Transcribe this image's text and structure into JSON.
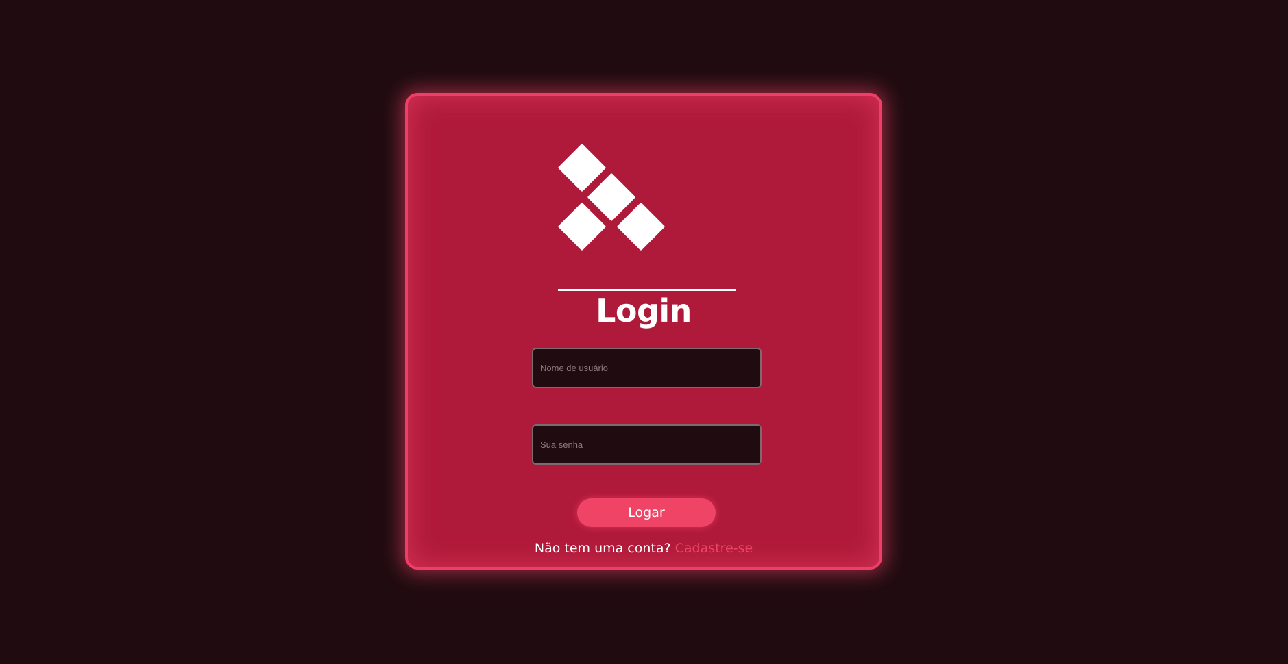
{
  "login": {
    "title": "Login",
    "username_placeholder": "Nome de usuário",
    "password_placeholder": "Sua senha",
    "submit_label": "Logar",
    "signup_prompt": "Não tem uma conta?",
    "signup_link": "Cadastre-se"
  },
  "colors": {
    "background": "#200c10",
    "card": "#b01a3a",
    "accent": "#ef3f66",
    "text": "#ffffff"
  }
}
